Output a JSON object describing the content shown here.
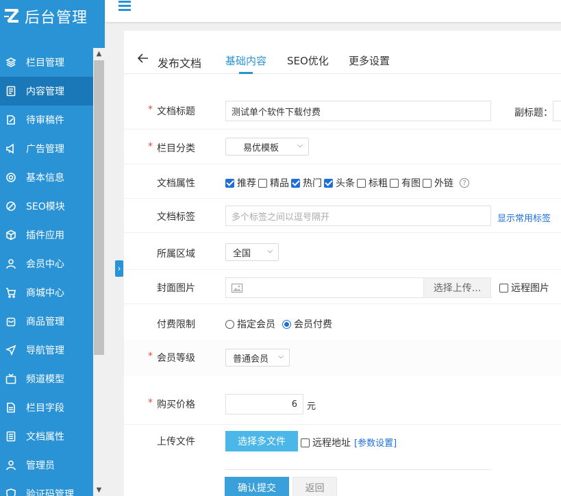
{
  "brand": {
    "logo_text": "后台管理",
    "accent": "#2a93d5"
  },
  "sidebar": {
    "items": [
      {
        "label": "栏目管理",
        "icon": "layers-icon"
      },
      {
        "label": "内容管理",
        "icon": "document-icon",
        "active": true
      },
      {
        "label": "待审稿件",
        "icon": "edit-icon"
      },
      {
        "label": "广告管理",
        "icon": "megaphone-icon"
      },
      {
        "label": "基本信息",
        "icon": "gear-icon"
      },
      {
        "label": "SEO模块",
        "icon": "seo-icon"
      },
      {
        "label": "插件应用",
        "icon": "cube-icon"
      },
      {
        "label": "会员中心",
        "icon": "user-icon"
      },
      {
        "label": "商城中心",
        "icon": "cart-icon"
      },
      {
        "label": "商品管理",
        "icon": "bag-icon"
      },
      {
        "label": "导航管理",
        "icon": "navigation-icon"
      },
      {
        "label": "频道模型",
        "icon": "tv-icon"
      },
      {
        "label": "栏目字段",
        "icon": "file-text-icon"
      },
      {
        "label": "文档属性",
        "icon": "list-icon"
      },
      {
        "label": "管理员",
        "icon": "admin-icon"
      },
      {
        "label": "验证码管理",
        "icon": "shield-icon"
      }
    ]
  },
  "header": {
    "back_title": "发布文档",
    "tabs": [
      "基础内容",
      "SEO优化",
      "更多设置"
    ]
  },
  "form": {
    "title_label": "文档标题",
    "title_value": "测试单个软件下载付费",
    "subtitle_label": "副标题：",
    "category_label": "栏目分类",
    "category_value": "易优模板",
    "attr_label": "文档属性",
    "attrs": [
      {
        "label": "推荐",
        "checked": true
      },
      {
        "label": "精品",
        "checked": false
      },
      {
        "label": "热门",
        "checked": true
      },
      {
        "label": "头条",
        "checked": true
      },
      {
        "label": "标粗",
        "checked": false
      },
      {
        "label": "有图",
        "checked": false
      },
      {
        "label": "外链",
        "checked": false
      }
    ],
    "tags_label": "文档标签",
    "tags_placeholder": "多个标签之间以逗号隔开",
    "tags_link": "显示常用标签",
    "region_label": "所属区域",
    "region_value": "全国",
    "cover_label": "封面图片",
    "cover_upload_button": "选择上传...",
    "cover_remote_label": "远程图片",
    "pay_label": "付费限制",
    "pay_options": [
      {
        "label": "指定会员",
        "selected": false
      },
      {
        "label": "会员付费",
        "selected": true
      }
    ],
    "level_label": "会员等级",
    "level_value": "普通会员",
    "price_label": "购买价格",
    "price_value": "6",
    "price_unit": "元",
    "upload_label": "上传文件",
    "upload_button": "选择多文件",
    "remote_addr_label": "远程地址",
    "param_link": "[参数设置]",
    "submit_button": "确认提交",
    "back_button": "返回"
  }
}
